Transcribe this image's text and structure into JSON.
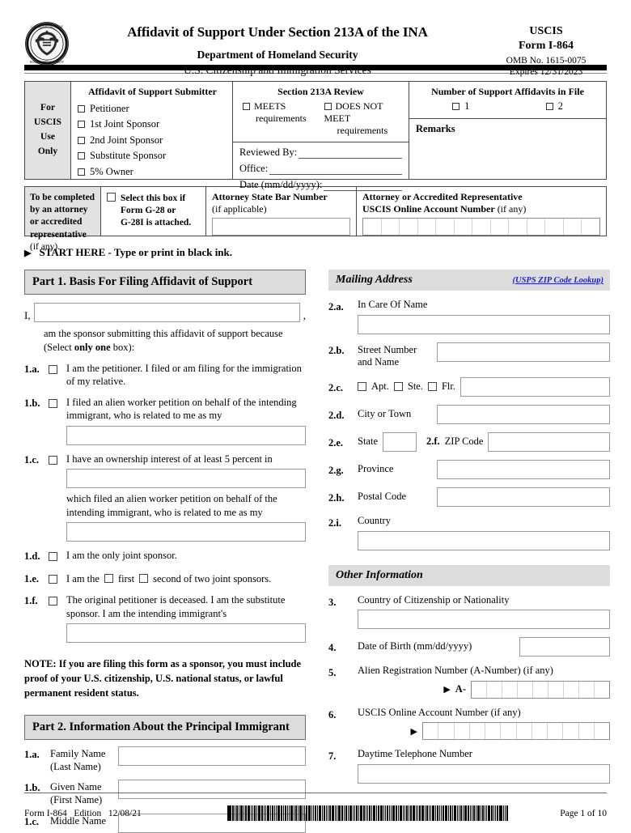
{
  "header": {
    "seal_icon": "dhs-seal-icon",
    "title": "Affidavit of Support Under Section 213A of the INA",
    "agency": "Department of Homeland Security",
    "bureau": "U.S. Citizenship and Immigration Services",
    "uscis": "USCIS",
    "form_number": "Form I-864",
    "omb": "OMB No. 1615-0075",
    "expires": "Expires 12/31/2023"
  },
  "uscis_use": {
    "left_label": "For\nUSCIS\nUse\nOnly",
    "submitter": {
      "heading": "Affidavit of Support Submitter",
      "options": [
        "Petitioner",
        "1st Joint Sponsor",
        "2nd Joint Sponsor",
        "Substitute Sponsor",
        "5% Owner"
      ]
    },
    "review": {
      "heading": "Section 213A Review",
      "meets": "MEETS",
      "meets_sub": "requirements",
      "does_not_meet": "DOES NOT MEET",
      "does_not_meet_sub": "requirements",
      "reviewed_by": "Reviewed By:",
      "office": "Office:",
      "date": "Date (mm/dd/yyyy):"
    },
    "affidavits": {
      "heading": "Number of Support Affidavits in File",
      "option_1": "1",
      "option_2": "2",
      "remarks": "Remarks"
    }
  },
  "attorney": {
    "left_label_bold": "To be completed by an attorney or accredited representative",
    "left_label_reg": " (if any).",
    "g28_line1": "Select this box if",
    "g28_line2": "Form G-28 or",
    "g28_line3": "G-28I is attached.",
    "bar_number_label": "Attorney State Bar Number",
    "bar_number_sub": "(if applicable)",
    "online_label_line1": "Attorney or Accredited Representative",
    "online_label_line2": "USCIS Online Account Number",
    "online_label_suffix": " (if any)",
    "online_cells": 13
  },
  "start_here": {
    "arrow_icon": "triangle-right-icon",
    "text": "START HERE - Type or print in black ink."
  },
  "part1": {
    "heading": "Part 1.  Basis For Filing Affidavit of Support",
    "i_label": "I,",
    "i_comma": ",",
    "intro_line1": "am the sponsor submitting this affidavit of support because",
    "intro_line2_pre": "(Select ",
    "intro_line2_bold": "only one",
    "intro_line2_post": " box):",
    "items": [
      {
        "num": "1.a.",
        "text": "I am the petitioner.  I filed or am filing for the immigration of my relative.",
        "field": false
      },
      {
        "num": "1.b.",
        "text": "I filed an alien worker petition on behalf of the intending immigrant, who is related to me as my",
        "field": true
      },
      {
        "num": "1.c.",
        "text": "I have an ownership interest of at least 5 percent in",
        "field": true,
        "text2": "which filed an alien worker petition on behalf of the intending immigrant, who is related to me as my",
        "field2": true
      },
      {
        "num": "1.d.",
        "text": "I am the only joint sponsor.",
        "field": false
      },
      {
        "num": "1.e.",
        "text_a": "I am the",
        "text_b": "first",
        "text_c": "second of two joint sponsors.",
        "field": false
      },
      {
        "num": "1.f.",
        "text": "The original petitioner is deceased.  I am the substitute sponsor.  I am the intending immigrant's",
        "field": true
      }
    ],
    "note": "NOTE:  If you are filing this form as a sponsor, you must include proof of your U.S. citizenship, U.S. national status, or lawful permanent resident status."
  },
  "part2": {
    "heading": "Part 2.  Information About the Principal Immigrant",
    "names": [
      {
        "num": "1.a.",
        "line1": "Family Name",
        "line2": "(Last Name)"
      },
      {
        "num": "1.b.",
        "line1": "Given Name",
        "line2": "(First Name)"
      },
      {
        "num": "1.c.",
        "line1": "Middle Name",
        "line2": ""
      }
    ]
  },
  "mailing": {
    "heading": "Mailing Address",
    "zip_link": "(USPS ZIP Code Lookup)",
    "a_num": "2.a.",
    "a_label": "In Care Of Name",
    "b_num": "2.b.",
    "b_label_1": "Street Number",
    "b_label_2": "and Name",
    "c_num": "2.c.",
    "c_apt": "Apt.",
    "c_ste": "Ste.",
    "c_flr": "Flr.",
    "d_num": "2.d.",
    "d_label": "City or Town",
    "e_num": "2.e.",
    "e_label": "State",
    "f_num": "2.f.",
    "f_label": "ZIP Code",
    "g_num": "2.g.",
    "g_label": "Province",
    "h_num": "2.h.",
    "h_label": "Postal Code",
    "i_num": "2.i.",
    "i_label": "Country"
  },
  "other_info": {
    "heading": "Other Information",
    "q3_num": "3.",
    "q3_label": "Country of Citizenship or Nationality",
    "q4_num": "4.",
    "q4_label": "Date of Birth (mm/dd/yyyy)",
    "q5_num": "5.",
    "q5_label": "Alien Registration Number (A-Number) (if any)",
    "q5_prefix": "A-",
    "q5_cells": 9,
    "q6_num": "6.",
    "q6_label": "USCIS Online Account Number (if any)",
    "q6_cells": 12,
    "q7_num": "7.",
    "q7_label": "Daytime Telephone Number",
    "arrow_icon": "triangle-right-icon"
  },
  "footer": {
    "form_edition": "Form I-864   Edition   12/08/21",
    "barcode_icon": "barcode-icon",
    "page": "Page 1 of 10"
  },
  "colors": {
    "shade": "#dcdcdc",
    "box_border": "#4a4a4a",
    "field_border": "#9a9a9a",
    "link": "#2222cc"
  }
}
